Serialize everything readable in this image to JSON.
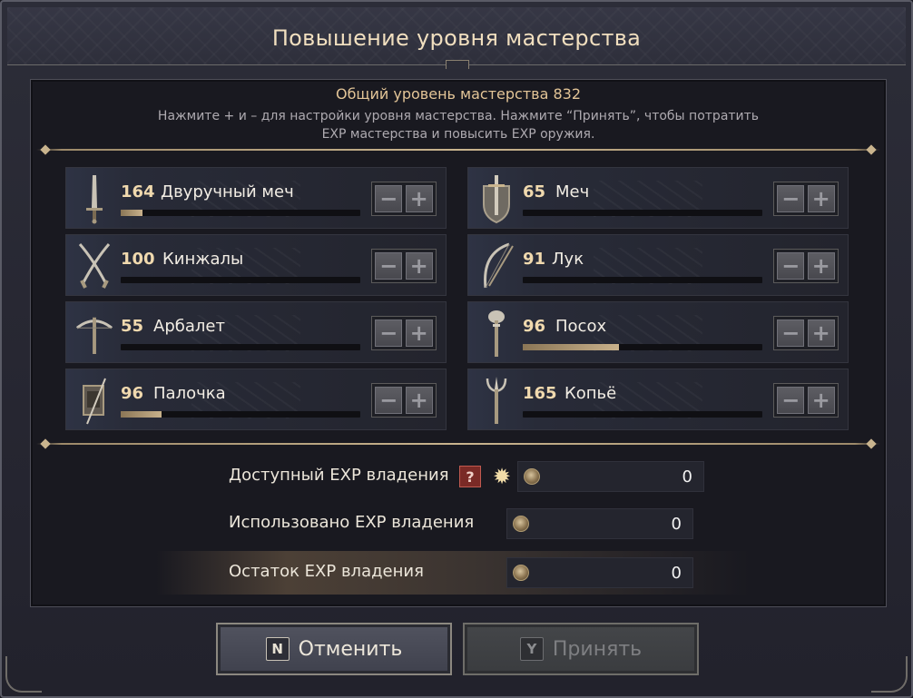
{
  "dialog": {
    "title": "Повышение уровня мастерства",
    "subtitle": "Общий уровень мастерства 832",
    "hint": "Нажмите + и – для настройки уровня мастерства. Нажмите “Принять”, чтобы потратить EXP мастерства и повысить EXP оружия."
  },
  "weapons": [
    {
      "level": "164",
      "name": "Двуручный меч",
      "icon": "greatsword-icon",
      "progress": 0.09
    },
    {
      "level": "65",
      "name": "Меч",
      "icon": "sword-shield-icon",
      "progress": 0.0
    },
    {
      "level": "100",
      "name": "Кинжалы",
      "icon": "daggers-icon",
      "progress": 0.0
    },
    {
      "level": "91",
      "name": "Лук",
      "icon": "bow-icon",
      "progress": 0.0
    },
    {
      "level": "55",
      "name": "Арбалет",
      "icon": "crossbow-icon",
      "progress": 0.0
    },
    {
      "level": "96",
      "name": "Посох",
      "icon": "staff-icon",
      "progress": 0.4
    },
    {
      "level": "96",
      "name": "Палочка",
      "icon": "wand-icon",
      "progress": 0.17
    },
    {
      "level": "165",
      "name": "Копьё",
      "icon": "spear-icon",
      "progress": 0.0
    }
  ],
  "controls": {
    "minus": "−",
    "plus": "+"
  },
  "exp": {
    "available_label": "Доступный EXP владения",
    "available_value": "0",
    "help": "?",
    "used_label": "Использовано EXP владения",
    "used_value": "0",
    "remaining_label": "Остаток EXP владения",
    "remaining_value": "0"
  },
  "buttons": {
    "cancel_key": "N",
    "cancel_label": "Отменить",
    "accept_key": "Y",
    "accept_label": "Принять"
  },
  "colors": {
    "accent": "#f1dfbf",
    "bar_fill": "#c8b18b",
    "help_badge": "#7a2a26"
  }
}
